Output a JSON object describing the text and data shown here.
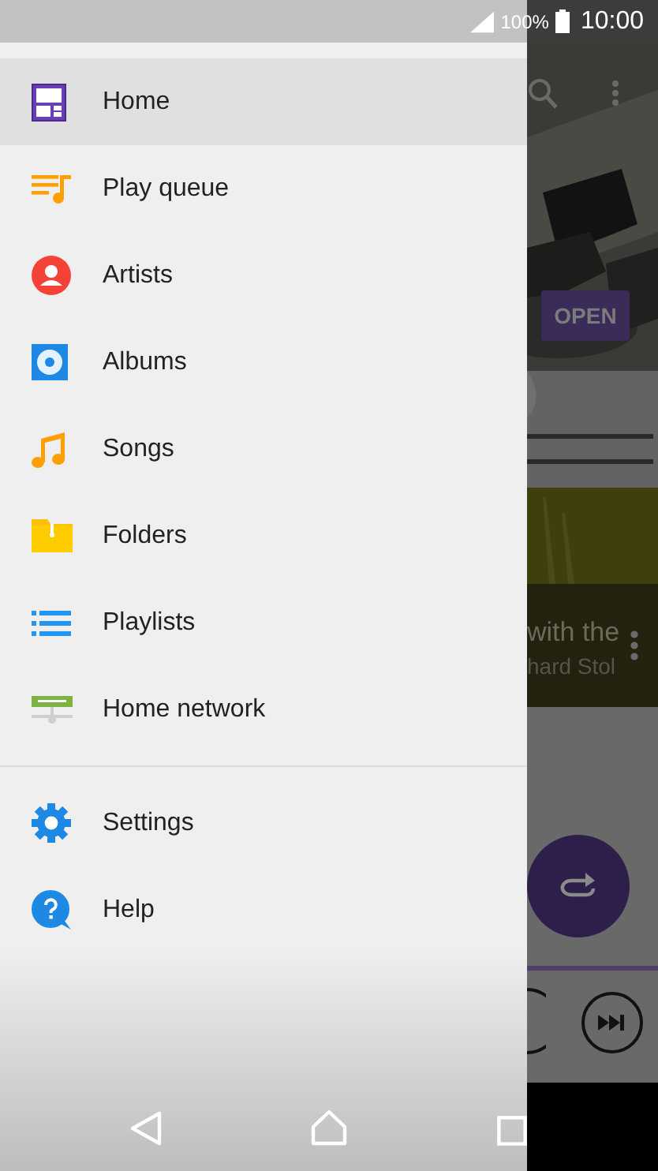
{
  "status_bar": {
    "battery_percent": "100%",
    "time": "10:00"
  },
  "drawer": {
    "items": [
      {
        "label": "Home",
        "kind": "home",
        "selected": true
      },
      {
        "label": "Play queue",
        "kind": "queue",
        "selected": false
      },
      {
        "label": "Artists",
        "kind": "artists",
        "selected": false
      },
      {
        "label": "Albums",
        "kind": "albums",
        "selected": false
      },
      {
        "label": "Songs",
        "kind": "songs",
        "selected": false
      },
      {
        "label": "Folders",
        "kind": "folders",
        "selected": false
      },
      {
        "label": "Playlists",
        "kind": "playlists",
        "selected": false
      },
      {
        "label": "Home network",
        "kind": "network",
        "selected": false
      }
    ],
    "footer_items": [
      {
        "label": "Settings",
        "kind": "settings",
        "selected": false
      },
      {
        "label": "Help",
        "kind": "help",
        "selected": false
      }
    ]
  },
  "background": {
    "open_button": "OPEN",
    "track_title": "with the",
    "track_artist": "hard Stol"
  }
}
